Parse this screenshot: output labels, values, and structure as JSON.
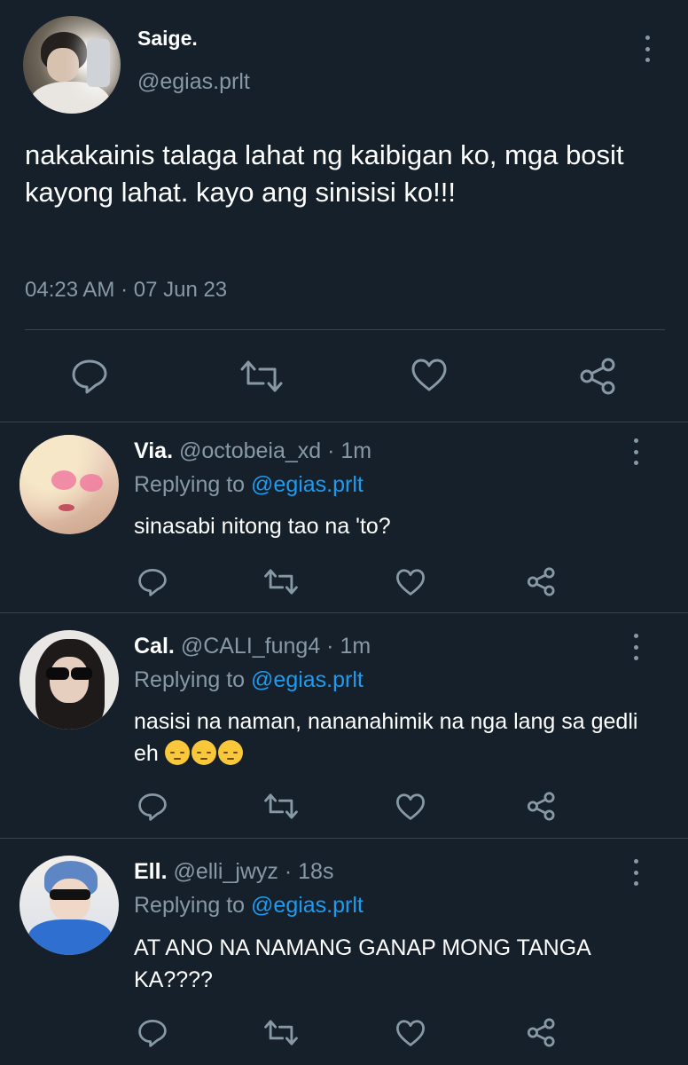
{
  "main_tweet": {
    "display_name": "Saige.",
    "handle": "@egias.prlt",
    "text": "nakakainis talaga lahat ng kaibigan ko, mga bosit kayong lahat. kayo ang sinisisi ko!!!",
    "timestamp": "04:23 AM · 07 Jun 23"
  },
  "replies": [
    {
      "display_name": "Via.",
      "handle_time": "@octobeia_xd · 1m",
      "replying_prefix": "Replying to",
      "replying_handle": "@egias.prlt",
      "text": "sinasabi nitong tao na 'to?"
    },
    {
      "display_name": "Cal.",
      "handle_time": "@CALI_fung4 · 1m",
      "replying_prefix": "Replying to",
      "replying_handle": "@egias.prlt",
      "text": "nasisi na naman, nananahimik na nga lang sa gedli eh",
      "emoji": "😔😔😔"
    },
    {
      "display_name": "Ell.",
      "handle_time": "@elli_jwyz · 18s",
      "replying_prefix": "Replying to",
      "replying_handle": "@egias.prlt",
      "text": "AT ANO NA NAMANG GANAP MONG TANGA KA????"
    }
  ],
  "icons": {
    "reply": "reply-icon",
    "retweet": "retweet-icon",
    "like": "heart-icon",
    "share": "share-icon",
    "more": "more-vertical-icon"
  },
  "colors": {
    "background": "#15202b",
    "text": "#ffffff",
    "muted": "#8899a6",
    "link": "#1d9bf0",
    "divider": "#38444d"
  }
}
